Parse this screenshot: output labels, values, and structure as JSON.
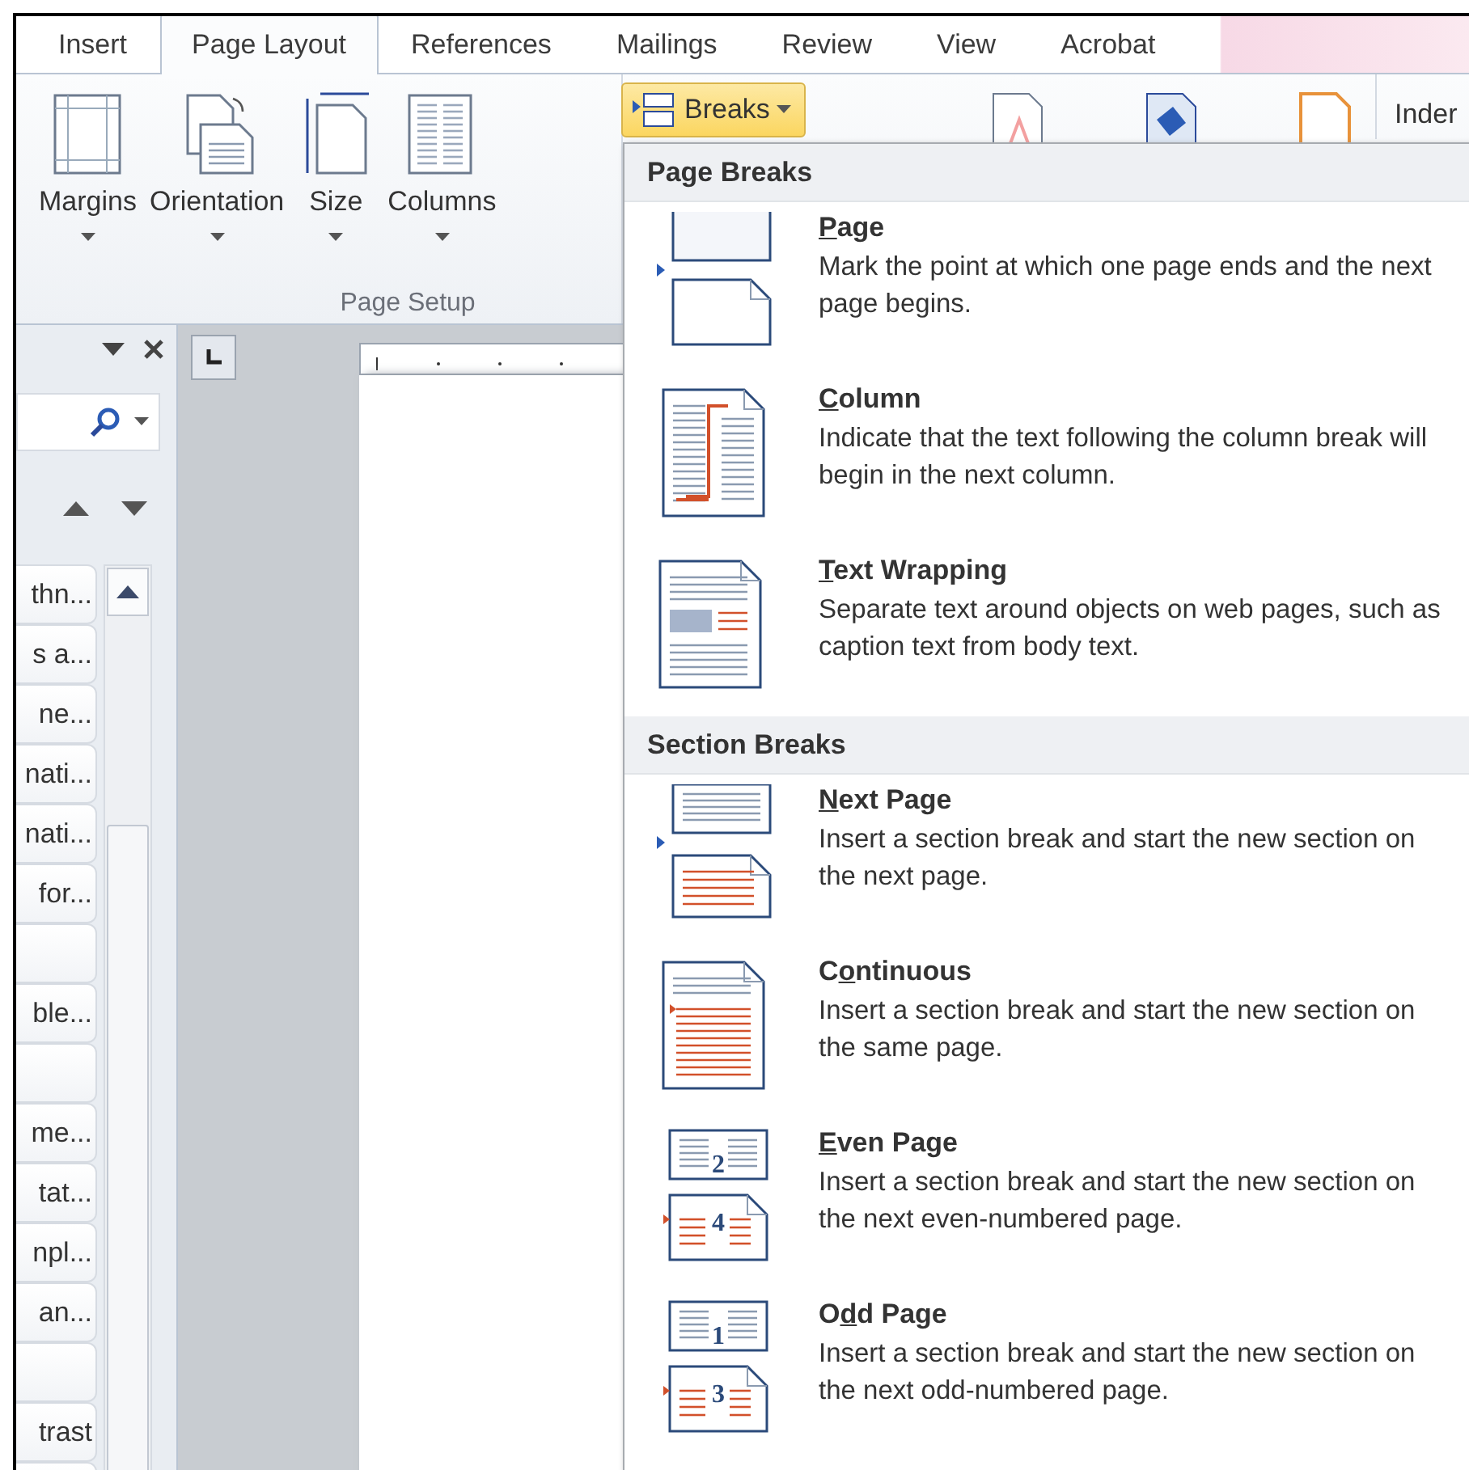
{
  "tabs": [
    {
      "label": "Insert",
      "selected": false
    },
    {
      "label": "Page Layout",
      "selected": true
    },
    {
      "label": "References",
      "selected": false
    },
    {
      "label": "Mailings",
      "selected": false
    },
    {
      "label": "Review",
      "selected": false
    },
    {
      "label": "View",
      "selected": false
    },
    {
      "label": "Acrobat",
      "selected": false
    }
  ],
  "ribbon": {
    "buttons": [
      {
        "kind": "margins",
        "label": "Margins"
      },
      {
        "kind": "orientation",
        "label": "Orientation"
      },
      {
        "kind": "size",
        "label": "Size"
      },
      {
        "kind": "columns",
        "label": "Columns"
      }
    ],
    "group_label": "Page Setup",
    "breaks_button": {
      "label": "Breaks",
      "pressed": true
    },
    "cut_label": "Inder"
  },
  "nav_pane": {
    "items": [
      {
        "kind": "text",
        "text": "thn..."
      },
      {
        "kind": "text",
        "text": "s a..."
      },
      {
        "kind": "text",
        "text": "ne..."
      },
      {
        "kind": "text",
        "text": "nati..."
      },
      {
        "kind": "text",
        "text": "nati..."
      },
      {
        "kind": "text",
        "text": "for..."
      },
      {
        "kind": "blank"
      },
      {
        "kind": "text",
        "text": "ble..."
      },
      {
        "kind": "blank"
      },
      {
        "kind": "text",
        "text": "me..."
      },
      {
        "kind": "text",
        "text": "tat..."
      },
      {
        "kind": "text",
        "text": "npl..."
      },
      {
        "kind": "text",
        "text": "an..."
      },
      {
        "kind": "blank"
      },
      {
        "kind": "text",
        "text": "trast"
      },
      {
        "kind": "blank"
      }
    ]
  },
  "menu": {
    "sections": [
      {
        "heading": "Page Breaks",
        "items": [
          {
            "kind": "page",
            "title": {
              "key": "P",
              "after": "age"
            },
            "description": "Mark the point at which one page ends and the next page begins."
          },
          {
            "kind": "column",
            "title": {
              "key": "C",
              "after": "olumn"
            },
            "description": "Indicate that the text following the column break will begin in the next column."
          },
          {
            "kind": "wrapping",
            "title": {
              "key": "T",
              "after": "ext Wrapping"
            },
            "description": "Separate text around objects on web pages, such as caption text from body text."
          }
        ]
      },
      {
        "heading": "Section Breaks",
        "items": [
          {
            "kind": "next",
            "title": {
              "key": "N",
              "after": "ext Page"
            },
            "description": "Insert a section break and start the new section on the next page."
          },
          {
            "kind": "continuous",
            "title": {
              "before": "C",
              "key": "o",
              "after": "ntinuous"
            },
            "description": "Insert a section break and start the new section on the same page."
          },
          {
            "kind": "numbered",
            "title": {
              "key": "E",
              "after": "ven Page"
            },
            "description": "Insert a section break and start the new section on the next even-numbered page.",
            "icon_numbers": [
              "2",
              "4"
            ]
          },
          {
            "kind": "numbered",
            "title": {
              "before": "O",
              "key": "d",
              "after": "d Page"
            },
            "description": "Insert a section break and start the new section on the next odd-numbered page.",
            "icon_numbers": [
              "1",
              "3"
            ]
          }
        ]
      }
    ]
  }
}
